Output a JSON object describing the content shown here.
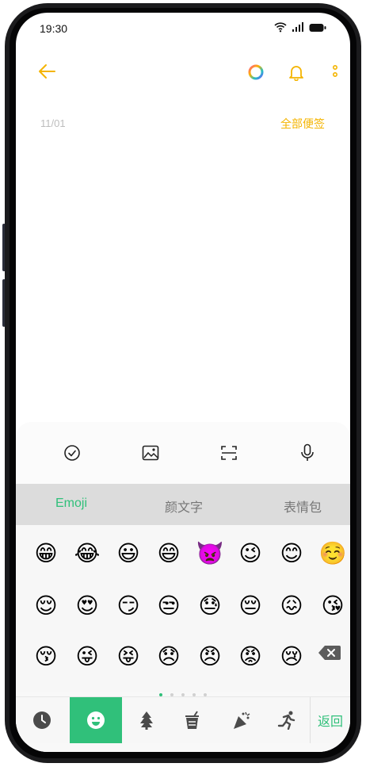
{
  "status_bar": {
    "time": "19:30",
    "icons": [
      "wifi-icon",
      "signal-icon",
      "battery-icon"
    ]
  },
  "toolbar": {
    "back_icon": "back-arrow-icon",
    "actions": [
      "color-ring-icon",
      "bell-icon",
      "more-vertical-icon"
    ]
  },
  "note": {
    "date": "11/01",
    "all_notes_label": "全部便签"
  },
  "tools": [
    "check-circle-icon",
    "image-icon",
    "scan-icon",
    "mic-icon"
  ],
  "emoji_tabs": [
    {
      "label": "Emoji",
      "active": true
    },
    {
      "label": "颜文字",
      "active": false
    },
    {
      "label": "表情包",
      "active": false
    }
  ],
  "emoji_rows": [
    [
      "😁",
      "😂",
      "😃",
      "😄",
      "👿",
      "😉",
      "😊",
      "☺️"
    ],
    [
      "😌",
      "😍",
      "😏",
      "😒",
      "😓",
      "😔",
      "😖",
      "😘"
    ],
    [
      "😚",
      "😜",
      "😝",
      "😞",
      "😠",
      "😡",
      "😢"
    ]
  ],
  "delete_icon": "backspace-icon",
  "page_dots": {
    "count": 5,
    "active": 0
  },
  "categories": [
    "clock-icon",
    "smiley-icon",
    "tree-icon",
    "food-icon",
    "party-icon",
    "runner-icon"
  ],
  "active_category": 1,
  "back_label": "返回",
  "colors": {
    "accent": "#30c07a",
    "toolbar": "#f4b400"
  }
}
